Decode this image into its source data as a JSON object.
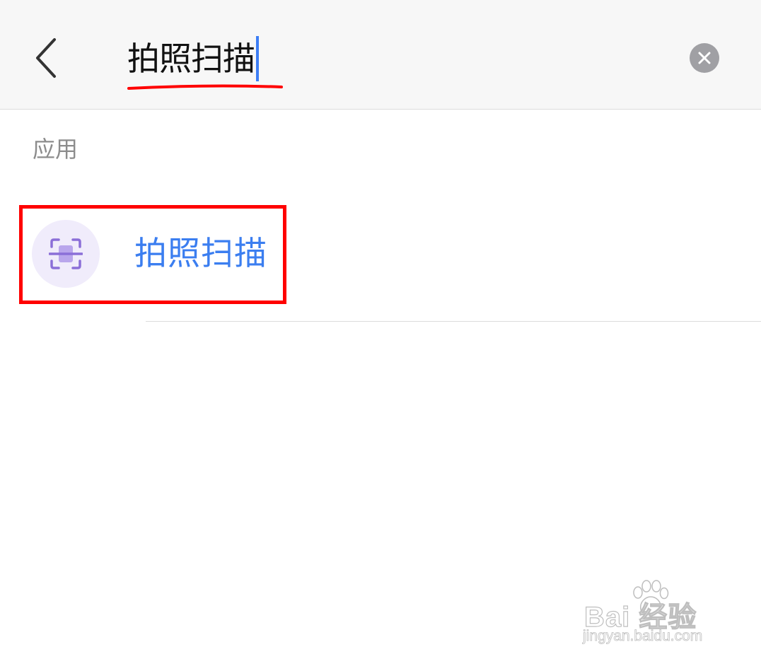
{
  "search": {
    "query": "拍照扫描"
  },
  "results": {
    "section_label": "应用",
    "items": [
      {
        "label": "拍照扫描",
        "icon": "scan-icon"
      }
    ]
  },
  "watermark": {
    "brand": "Bai 经验",
    "url": "jingyan.baidu.com"
  },
  "colors": {
    "accent": "#3b7ef0",
    "caret": "#3d7ef5",
    "highlight": "#ff0000",
    "icon_bg": "#f0ecfb",
    "icon_fg": "#8b6fd8",
    "header_bg": "#f7f7f7",
    "clear_button_bg": "#a0a0a4"
  }
}
